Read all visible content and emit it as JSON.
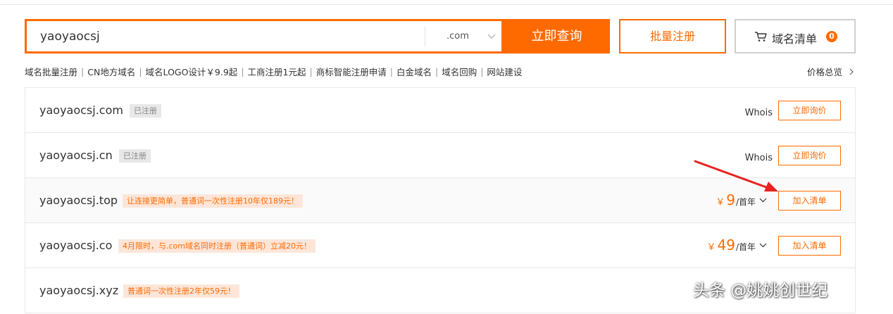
{
  "search": {
    "query": "yaoyaocsj",
    "tld": ".com",
    "button": "立即查询"
  },
  "bulk_register": "批量注册",
  "cart": {
    "label": "域名清单",
    "count": "0"
  },
  "nav_links": [
    "域名批量注册",
    "CN地方域名",
    "域名LOGO设计￥9.9起",
    "工商注册1元起",
    "商标智能注册申请",
    "白金域名",
    "域名回购",
    "网站建设"
  ],
  "price_overview": "价格总览",
  "results": [
    {
      "domain": "yaoyaocsj.com",
      "tag": "已注册",
      "whois": "Whois",
      "action": "立即询价"
    },
    {
      "domain": "yaoyaocsj.cn",
      "tag": "已注册",
      "whois": "Whois",
      "action": "立即询价"
    },
    {
      "domain": "yaoyaocsj.top",
      "promo": "让连接更简单，普通词一次性注册10年仅189元！",
      "currency": "￥",
      "price": "9",
      "unit": "/首年",
      "action": "加入清单"
    },
    {
      "domain": "yaoyaocsj.co",
      "promo": "4月限时，与.com域名同时注册（普通词）立减20元！",
      "currency": "￥",
      "price": "49",
      "unit": "/首年",
      "action": "加入清单"
    },
    {
      "domain": "yaoyaocsj.xyz",
      "promo": "普通词一次性注册2年仅59元！"
    }
  ],
  "watermark": "头条 @姚姚创世纪",
  "colors": {
    "accent": "#ff6a00",
    "promo_bg": "#fde6d9",
    "tag_bg": "#e8e8e8",
    "arrow": "#e8231f"
  },
  "icons": [
    "cart-icon",
    "chevron-down-icon",
    "chevron-right-icon",
    "red-arrow-annotation"
  ]
}
